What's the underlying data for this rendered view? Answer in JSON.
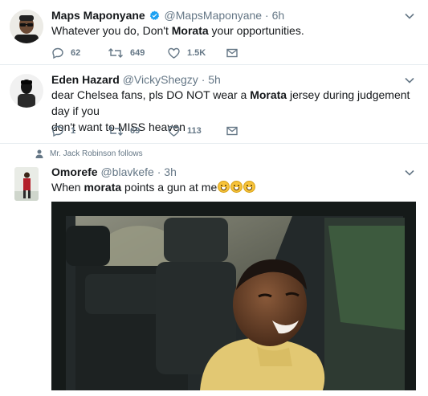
{
  "tweets": [
    {
      "name": "Maps Maponyane",
      "handle": "@MapsMaponyane",
      "sep": "·",
      "time": "6h",
      "verified": true,
      "text_before": "Whatever you do, Don't ",
      "text_bold": "Morata",
      "text_after": " your opportunities.",
      "replies": "62",
      "retweets": "649",
      "likes": "1.5K"
    },
    {
      "name": "Eden Hazard",
      "handle": "@VickyShegzy",
      "sep": "·",
      "time": "5h",
      "text_line1_before": "dear Chelsea fans, pls DO NOT wear a ",
      "text_bold": "Morata",
      "text_line1_after": " jersey during judgement day if you",
      "text_line2": "don't want to MISS heaven",
      "replies": "1",
      "retweets": "69",
      "likes": "113"
    },
    {
      "social_context": "Mr. Jack Robinson follows",
      "name": "Omorefe",
      "handle": "@blavkefe",
      "sep": "·",
      "time": "3h",
      "text_before": "When ",
      "text_bold": "morata",
      "text_after": " points a gun at me",
      "emoji": [
        "grinning-face",
        "grinning-face",
        "grinning-face"
      ]
    }
  ],
  "colors": {
    "text": "#14171a",
    "meta": "#657786",
    "verified": "#1da1f2",
    "divider": "#e6ecf0"
  }
}
